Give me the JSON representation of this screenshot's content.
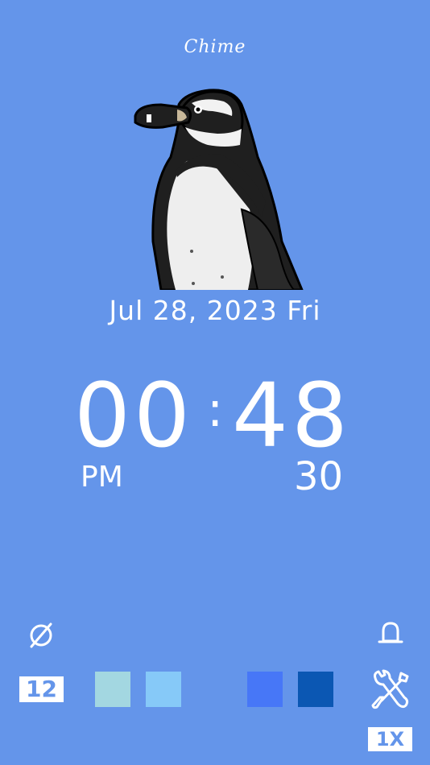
{
  "app": {
    "title": "Chime"
  },
  "clock": {
    "date": "Jul 28, 2023",
    "weekday": "Fri",
    "hours": "00",
    "minutes": "48",
    "seconds": "30",
    "ampm": "PM"
  },
  "controls": {
    "hour_format": "12",
    "speed": "1X",
    "left_icon": "no-sound-icon",
    "right_icon": "bell-icon",
    "settings_icon": "tools-icon"
  },
  "swatches": [
    {
      "name": "swatch-teal-light",
      "color": "#a3d7e1"
    },
    {
      "name": "swatch-sky",
      "color": "#86c9f8"
    },
    {
      "name": "swatch-blue",
      "color": "#4777f7"
    },
    {
      "name": "swatch-navy",
      "color": "#0b57b3"
    }
  ],
  "colors": {
    "background": "#6495ea",
    "text": "#ffffff"
  }
}
